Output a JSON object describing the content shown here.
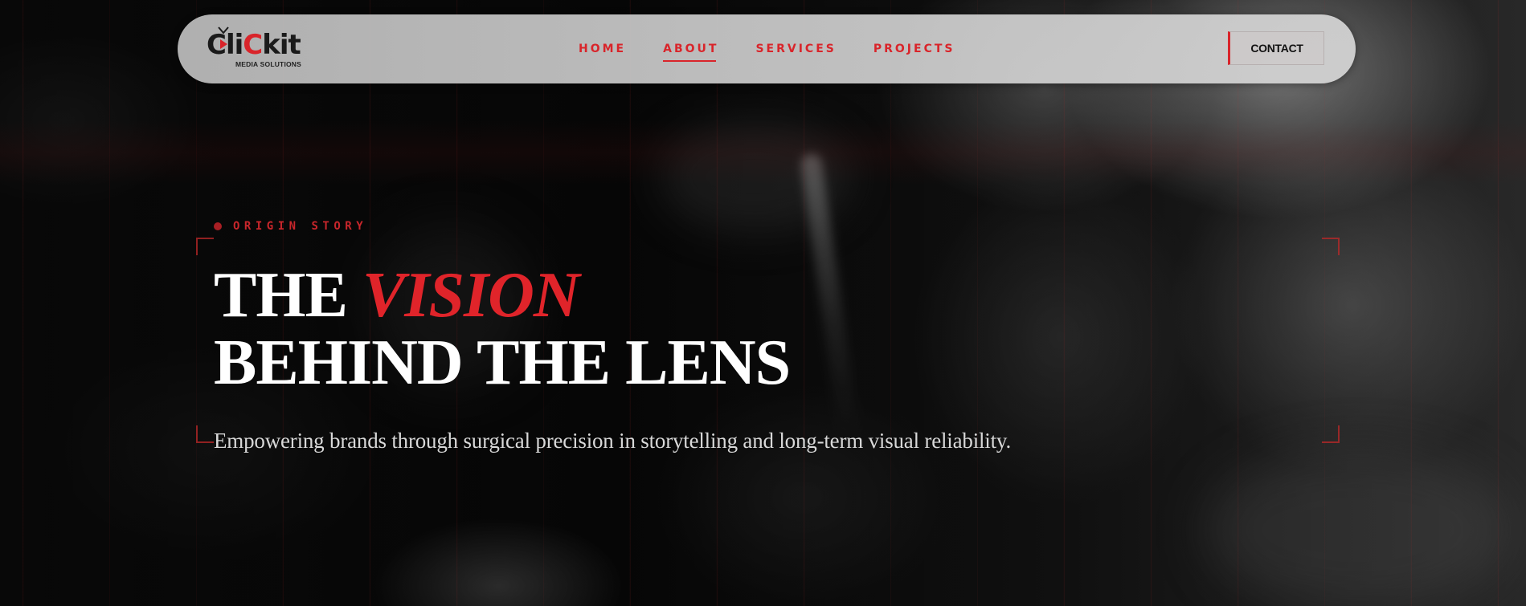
{
  "brand": {
    "name_part1": "Cli",
    "name_part2": "C",
    "name_part3": "kit",
    "tagline": "MEDIA SOLUTIONS"
  },
  "nav": {
    "items": [
      {
        "label": "HOME",
        "active": false
      },
      {
        "label": "ABOUT",
        "active": true
      },
      {
        "label": "SERVICES",
        "active": false
      },
      {
        "label": "PROJECTS",
        "active": false
      }
    ],
    "contact_label": "CONTACT"
  },
  "hero": {
    "eyebrow": "ORIGIN STORY",
    "title_line1_a": "THE ",
    "title_line1_b": "VISION",
    "title_line2": "BEHIND THE LENS",
    "subtitle": "Empowering brands through surgical precision in storytelling and long-term visual reliability."
  },
  "colors": {
    "accent": "#d9242a",
    "nav_bg": "#c8c8c8",
    "hero_text": "#ffffff"
  }
}
